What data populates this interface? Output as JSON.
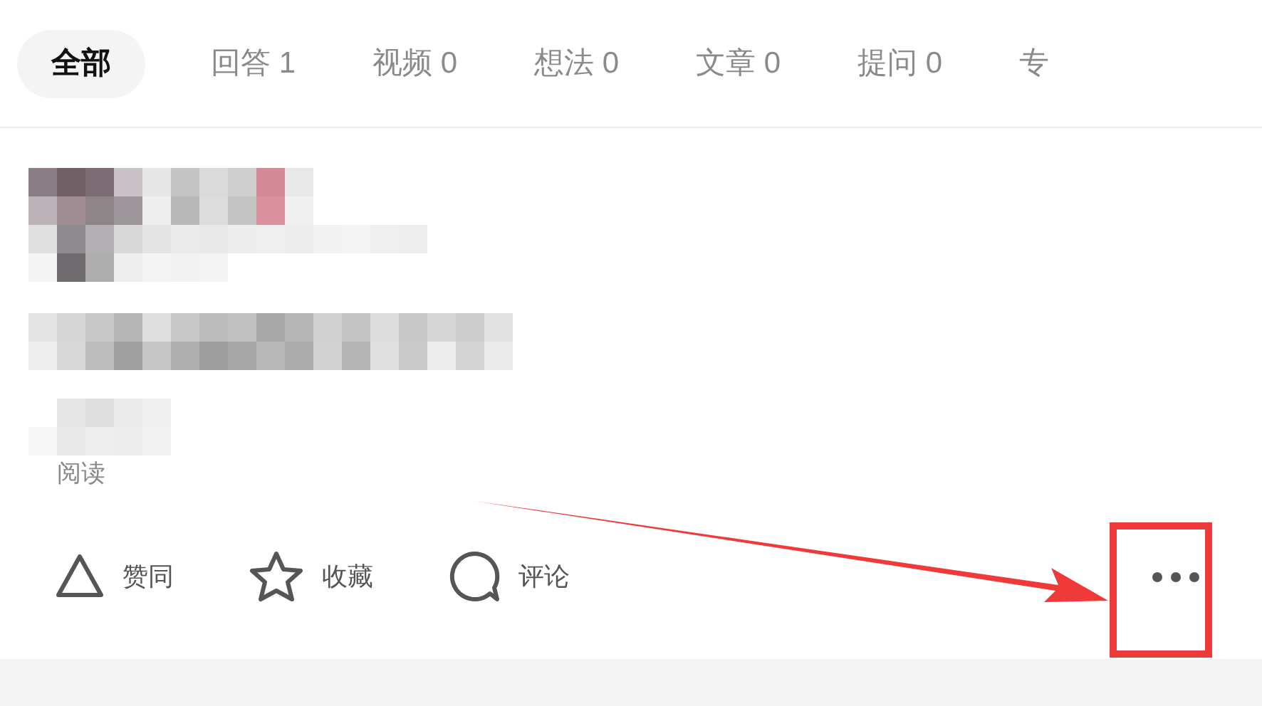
{
  "tabs": [
    {
      "label": "全部",
      "selected": true
    },
    {
      "label": "回答 1",
      "selected": false
    },
    {
      "label": "视频 0",
      "selected": false
    },
    {
      "label": "想法 0",
      "selected": false
    },
    {
      "label": "文章 0",
      "selected": false
    },
    {
      "label": "提问 0",
      "selected": false
    },
    {
      "label": "专",
      "selected": false
    }
  ],
  "post": {
    "meta": "阅读"
  },
  "actions": [
    {
      "kind": "upvote",
      "label": "赞同"
    },
    {
      "kind": "favorite",
      "label": "收藏"
    },
    {
      "kind": "comment",
      "label": "评论"
    }
  ]
}
